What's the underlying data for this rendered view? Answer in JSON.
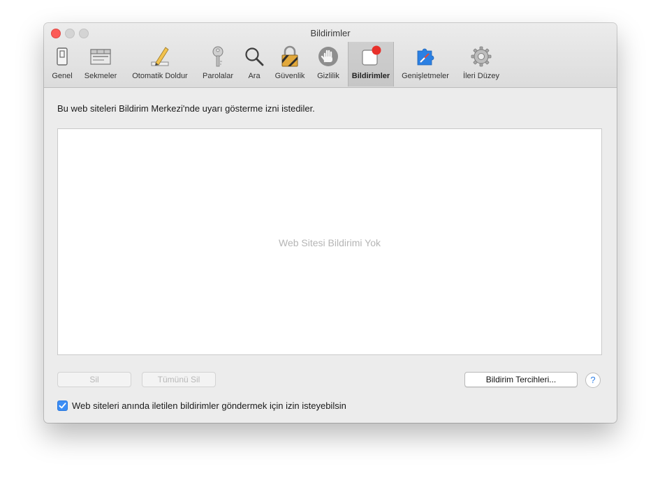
{
  "window": {
    "title": "Bildirimler"
  },
  "toolbar": {
    "items": [
      {
        "label": "Genel",
        "icon": "general-switch-icon",
        "selected": false
      },
      {
        "label": "Sekmeler",
        "icon": "tabs-icon",
        "selected": false
      },
      {
        "label": "Otomatik Doldur",
        "icon": "pencil-icon",
        "selected": false
      },
      {
        "label": "Parolalar",
        "icon": "key-icon",
        "selected": false
      },
      {
        "label": "Ara",
        "icon": "magnifier-icon",
        "selected": false
      },
      {
        "label": "Güvenlik",
        "icon": "padlock-icon",
        "selected": false
      },
      {
        "label": "Gizlilik",
        "icon": "hand-icon",
        "selected": false
      },
      {
        "label": "Bildirimler",
        "icon": "notification-icon",
        "selected": true
      },
      {
        "label": "Genişletmeler",
        "icon": "puzzle-piece-icon",
        "selected": false
      },
      {
        "label": "İleri Düzey",
        "icon": "gear-icon",
        "selected": false
      }
    ]
  },
  "main": {
    "description": "Bu web siteleri Bildirim Merkezi'nde uyarı gösterme izni istediler.",
    "empty_text": "Web Sitesi Bildirimi Yok",
    "remove_label": "Sil",
    "remove_all_label": "Tümünü Sil",
    "preferences_label": "Bildirim Tercihleri...",
    "help_label": "?",
    "allow_checkbox": {
      "label": "Web siteleri anında iletilen bildirimler göndermek için izin isteyebilsin",
      "checked": true
    }
  },
  "colors": {
    "accent": "#3b8df5",
    "close": "#fc5b57",
    "notification_dot": "#e8302a"
  }
}
